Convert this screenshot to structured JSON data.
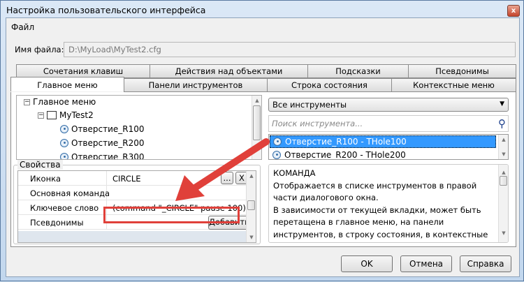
{
  "window": {
    "title": "Настройка пользовательского интерфейса",
    "close_label": "x"
  },
  "menu": {
    "file": "Файл"
  },
  "file": {
    "label": "Имя файла:",
    "value": "D:\\MyLoad\\MyTest2.cfg"
  },
  "tabs_row1": [
    "Сочетания клавиш",
    "Действия над объектами",
    "Подсказки",
    "Псевдонимы"
  ],
  "tabs_row2": [
    "Главное меню",
    "Панели инструментов",
    "Строка состояния",
    "Контекстные меню"
  ],
  "tree": {
    "root": "Главное меню",
    "child": "MyTest2",
    "items": [
      "Отверстие_R100",
      "Отверстие_R200",
      "Отверстие_R300"
    ]
  },
  "properties": {
    "title": "Свойства",
    "rows": [
      {
        "key": "Иконка",
        "value": "CIRCLE"
      },
      {
        "key": "Основная команда",
        "value": ""
      },
      {
        "key": "Ключевое слово",
        "value": "(command \"_CIRCLE\" pause 100);"
      },
      {
        "key": "Псевдонимы",
        "value": ""
      }
    ],
    "browse_label": "...",
    "clear_label": "X",
    "add_label": "Добавить"
  },
  "tools": {
    "filter": "Все инструменты",
    "search_placeholder": "Поиск инструмента...",
    "items": [
      "Отверстие_R100 - THole100",
      "Отверстие_R200 - THole200"
    ]
  },
  "description": {
    "heading": "КОМАНДА",
    "lines": [
      "Отображается в списке инструментов в правой части диалогового окна.",
      "В зависимости от текущей вкладки, может быть перетащена в главное меню, на панели инструментов, в строку состояния, в контекстные меню. Создание псевдонимов и горячих клавиш выбранной команды"
    ]
  },
  "buttons": {
    "ok": "OK",
    "cancel": "Отмена",
    "help": "Справка"
  },
  "colors": {
    "accent": "#3399ff",
    "annotation": "#e0403a"
  }
}
